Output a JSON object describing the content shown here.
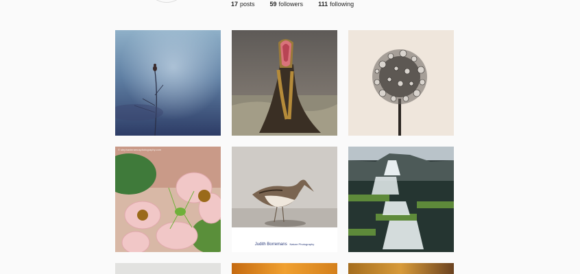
{
  "profile": {
    "stats": [
      {
        "count": "17",
        "label": "posts"
      },
      {
        "count": "59",
        "label": "followers"
      },
      {
        "count": "111",
        "label": "following"
      }
    ]
  },
  "posts": [
    {
      "subject": "bird-on-twig-blue-mist"
    },
    {
      "subject": "lizard-open-mouth"
    },
    {
      "subject": "dandelion-seed-head-dew"
    },
    {
      "subject": "green-insect-on-pink-flowers",
      "caption": "© stephanieramusphotography.com"
    },
    {
      "subject": "snipe-bird",
      "caption": "Judith Borremans",
      "caption_suffix": "Nature Photography"
    },
    {
      "subject": "waterfall-cliffs"
    },
    {
      "subject": "partial-grey"
    },
    {
      "subject": "partial-orange"
    },
    {
      "subject": "partial-amber"
    }
  ],
  "colors": {
    "background": "#fafafa",
    "text": "#262626"
  }
}
